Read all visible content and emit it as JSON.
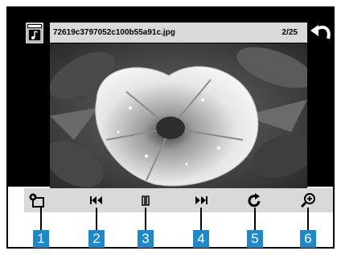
{
  "header": {
    "filename": "72619c3797052c100b55a91c.jpg",
    "counter": "2/25",
    "left_icon": "music-file-icon",
    "right_icon": "back-arrow-icon"
  },
  "controls": [
    {
      "name": "slideshow-settings-button",
      "icon": "settings-slideshow-icon",
      "marker": "1"
    },
    {
      "name": "previous-button",
      "icon": "skip-previous-icon",
      "marker": "2"
    },
    {
      "name": "pause-button",
      "icon": "pause-icon",
      "marker": "3"
    },
    {
      "name": "next-button",
      "icon": "skip-next-icon",
      "marker": "4"
    },
    {
      "name": "rotate-button",
      "icon": "rotate-icon",
      "marker": "5"
    },
    {
      "name": "zoom-button",
      "icon": "zoom-in-icon",
      "marker": "6"
    }
  ],
  "colors": {
    "badge": "#1e88c8",
    "strip": "#d9d9d9",
    "screen": "#000000"
  }
}
